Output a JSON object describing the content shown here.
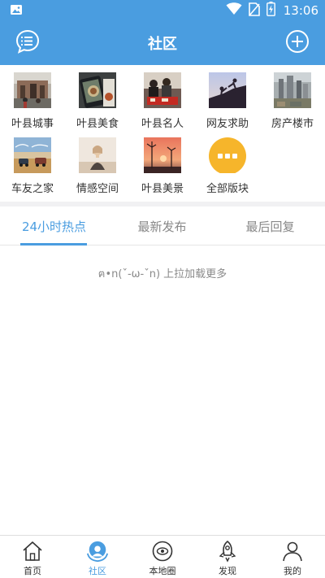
{
  "status_bar": {
    "time": "13:06"
  },
  "header": {
    "title": "社区"
  },
  "categories": [
    {
      "label": "叶县城事",
      "thumb": "photo-street"
    },
    {
      "label": "叶县美食",
      "thumb": "photo-food"
    },
    {
      "label": "叶县名人",
      "thumb": "photo-people"
    },
    {
      "label": "网友求助",
      "thumb": "photo-help"
    },
    {
      "label": "房产楼市",
      "thumb": "photo-buildings"
    },
    {
      "label": "车友之家",
      "thumb": "photo-cars"
    },
    {
      "label": "情感空间",
      "thumb": "photo-emotion"
    },
    {
      "label": "叶县美景",
      "thumb": "photo-scenery"
    },
    {
      "label": "全部版块",
      "thumb": "more-icon"
    }
  ],
  "tabs": [
    {
      "label": "24小时热点",
      "active": true
    },
    {
      "label": "最新发布",
      "active": false
    },
    {
      "label": "最后回复",
      "active": false
    }
  ],
  "load_more_text": "ฅ•n(ˇ-ω-ˇn) 上拉加载更多",
  "bottom_nav": [
    {
      "label": "首页",
      "icon": "home-icon",
      "active": false
    },
    {
      "label": "社区",
      "icon": "community-icon",
      "active": true
    },
    {
      "label": "本地圈",
      "icon": "local-circle-icon",
      "active": false
    },
    {
      "label": "发现",
      "icon": "rocket-icon",
      "active": false
    },
    {
      "label": "我的",
      "icon": "profile-icon",
      "active": false
    }
  ],
  "colors": {
    "primary": "#4a9de0",
    "accent": "#f6b52b",
    "text": "#333333",
    "muted": "#888888"
  }
}
